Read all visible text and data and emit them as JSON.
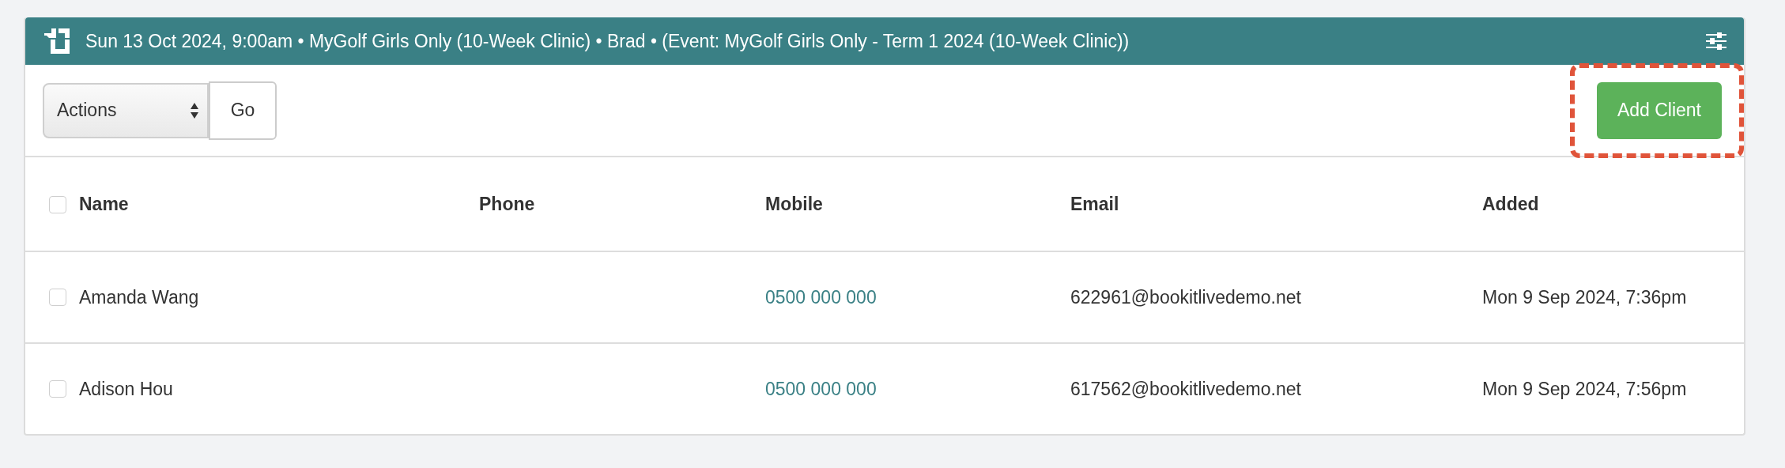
{
  "header": {
    "title": "Sun 13 Oct 2024, 9:00am • MyGolf Girls Only (10-Week Clinic) • Brad • (Event: MyGolf Girls Only - Term 1 2024 (10-Week Clinic))"
  },
  "toolbar": {
    "actions_select": "Actions",
    "go_button": "Go",
    "add_client_button": {
      "label": "Add Client",
      "highlighted": true
    }
  },
  "table": {
    "select_all_checked": false,
    "columns": [
      "Name",
      "Phone",
      "Mobile",
      "Email",
      "Added"
    ],
    "rows": [
      {
        "checked": false,
        "name": "Amanda Wang",
        "mobile": "0500 000 000",
        "email": "622961@bookitlivedemo.net",
        "added": "Mon 9 Sep 2024, 7:36pm"
      },
      {
        "checked": false,
        "name": "Adison Hou",
        "mobile": "0500 000 000",
        "email": "617562@bookitlivedemo.net",
        "added": "Mon 9 Sep 2024, 7:56pm"
      }
    ]
  }
}
